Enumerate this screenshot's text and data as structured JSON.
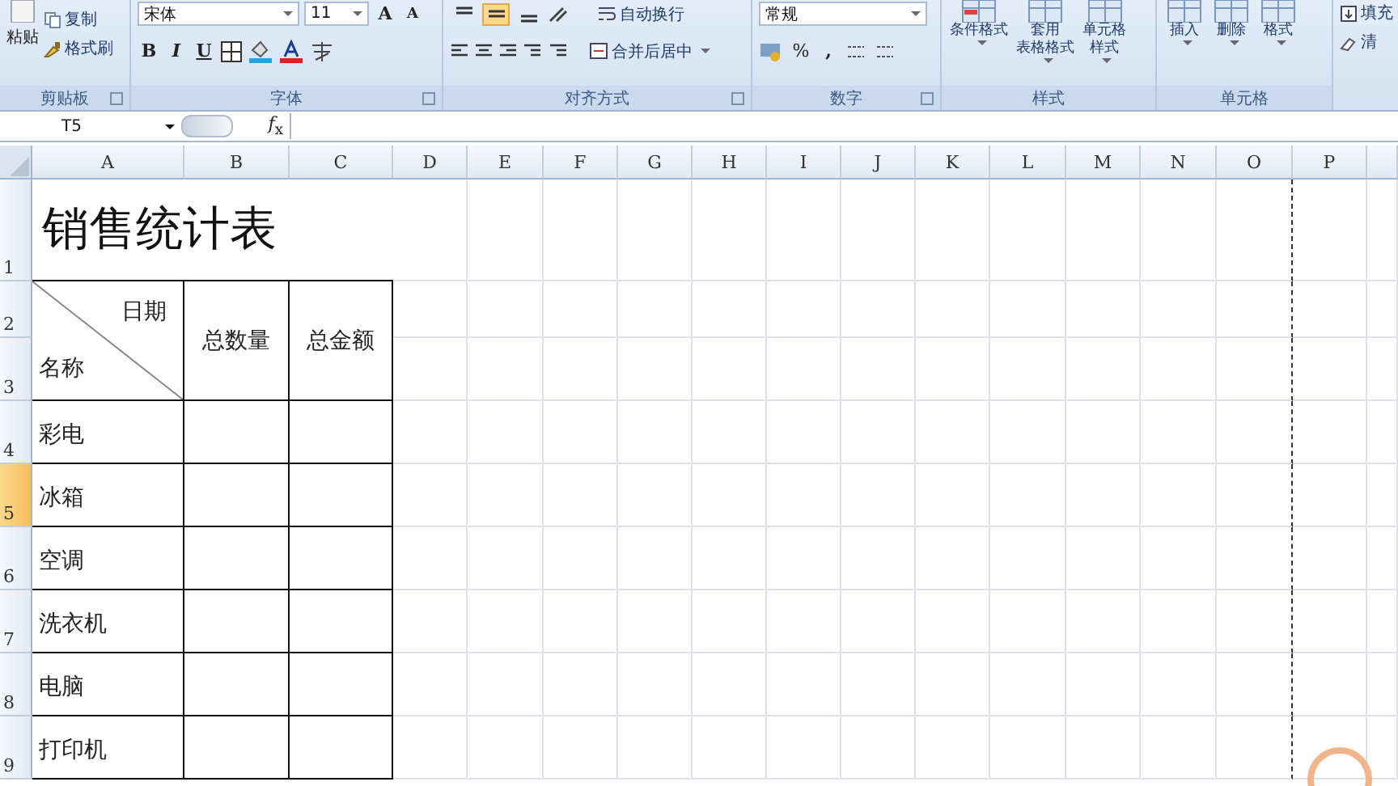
{
  "ribbon": {
    "groups": [
      {
        "kind": "clipboard",
        "label": "剪贴板",
        "paste": "粘贴",
        "items": [
          "复制",
          "格式刷"
        ]
      },
      {
        "kind": "font",
        "label": "字体",
        "font_name": "宋体",
        "font_size": "11",
        "grow": "A",
        "shrink": "A",
        "styles": [
          "B",
          "I",
          "U"
        ]
      },
      {
        "kind": "alignment",
        "label": "对齐方式",
        "vertical_align": [
          {
            "selected": false
          },
          {
            "selected": true
          },
          {
            "selected": false
          }
        ],
        "wrap": "自动换行",
        "merge": "合并后居中"
      },
      {
        "kind": "number",
        "label": "数字",
        "format": "常规",
        "percent": "%",
        "comma": ","
      },
      {
        "kind": "styles",
        "label": "样式",
        "buttons": [
          [
            "条件格式"
          ],
          [
            "套用",
            "表格格式"
          ],
          [
            "单元格",
            "样式"
          ]
        ]
      },
      {
        "kind": "cells",
        "label": "单元格",
        "buttons": [
          "插入",
          "删除",
          "格式"
        ]
      },
      {
        "kind": "editing",
        "items": [
          "填充",
          "清"
        ]
      }
    ]
  },
  "formula_bar": {
    "name_box": "T5",
    "fx": "*f*$_{x}$"
  },
  "sheet": {
    "columns": [
      "A",
      "B",
      "C",
      "D",
      "E",
      "F",
      "G",
      "H",
      "I",
      "J",
      "K",
      "L",
      "M",
      "N",
      "O",
      "P"
    ],
    "rows": [
      {
        "label": "1",
        "selected": false
      },
      {
        "label": "2",
        "selected": false
      },
      {
        "label": "3",
        "selected": false
      },
      {
        "label": "4",
        "selected": false
      },
      {
        "label": "5",
        "selected": true
      },
      {
        "label": "6",
        "selected": false
      },
      {
        "label": "7",
        "selected": false
      },
      {
        "label": "8",
        "selected": false
      },
      {
        "label": "9",
        "selected": false
      }
    ],
    "title": "销售统计表",
    "diagonal_top": "日期",
    "diagonal_bottom": "名称",
    "headers": [
      "总数量",
      "总金额"
    ],
    "items": [
      "彩电",
      "冰箱",
      "空调",
      "洗衣机",
      "电脑",
      "打印机"
    ]
  }
}
